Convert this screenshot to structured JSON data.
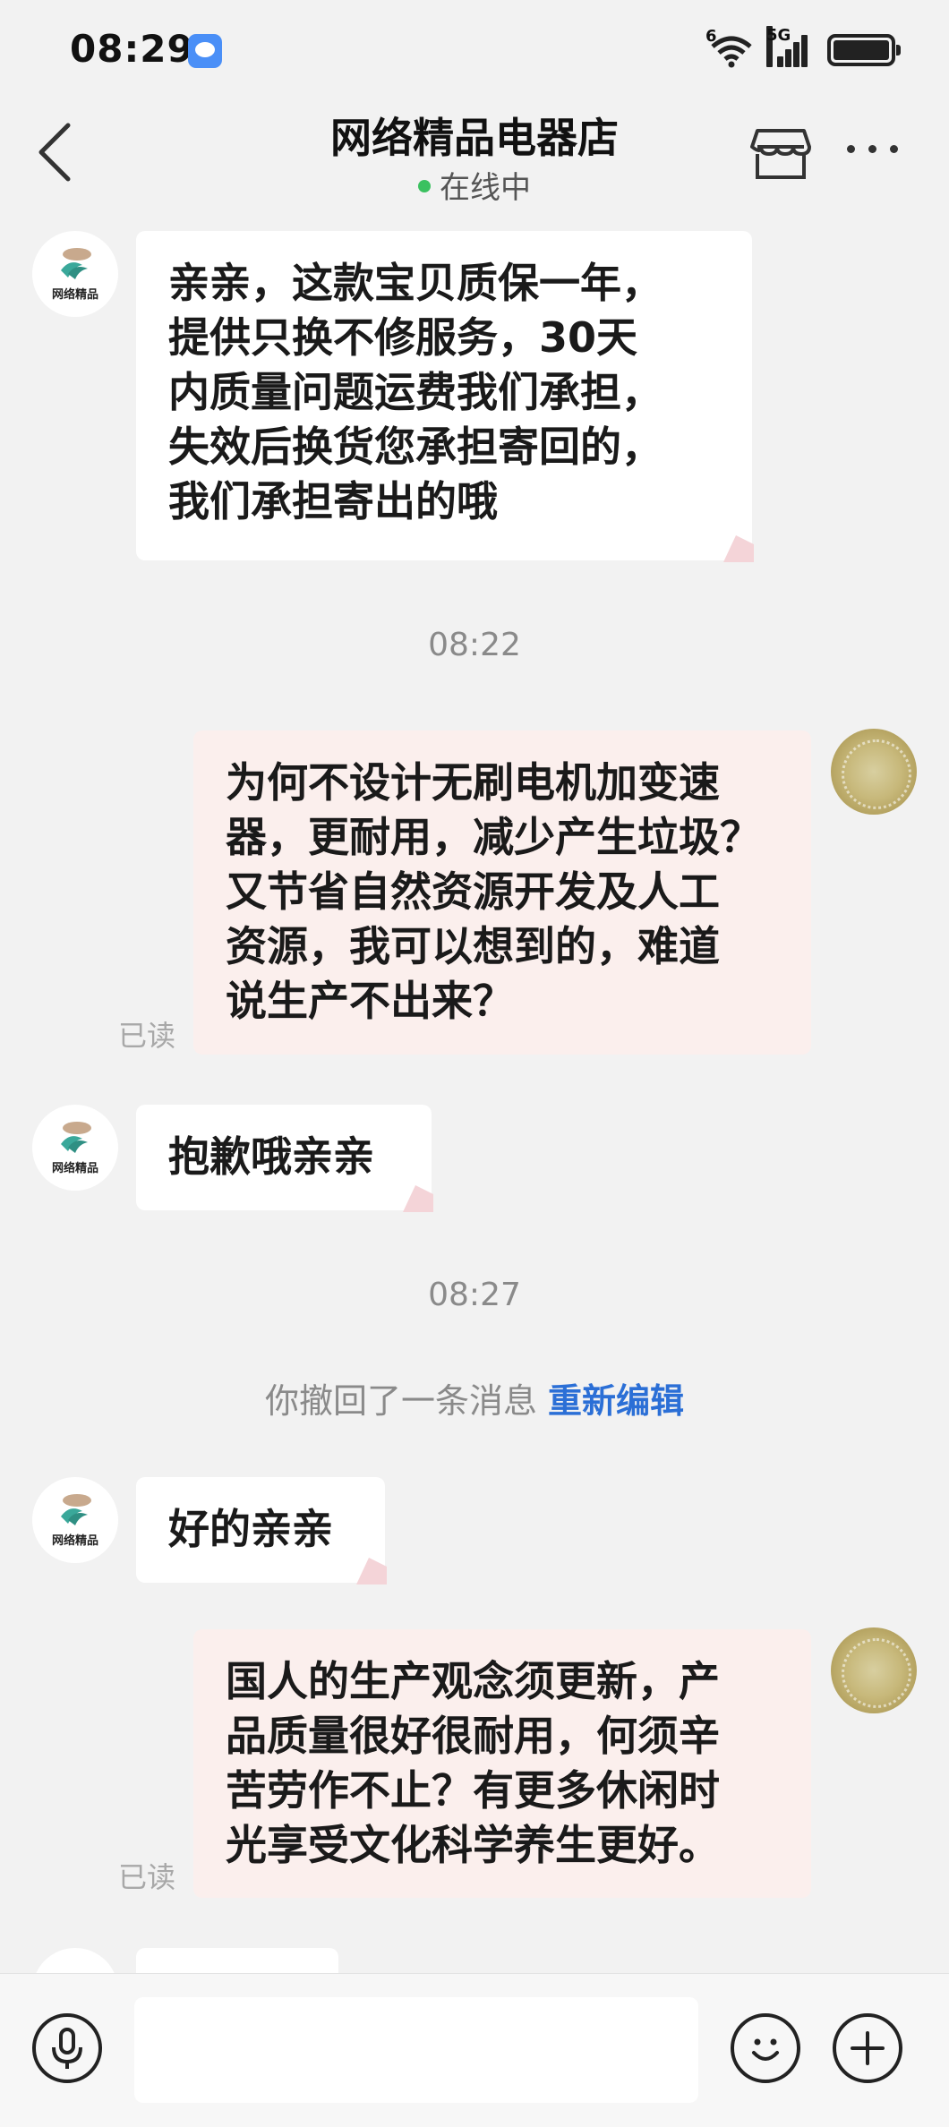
{
  "status_bar": {
    "time": "08:29",
    "network_label": "5G",
    "wifi_label": "6",
    "notification_icon": "chat-bubble-icon"
  },
  "header": {
    "title": "网络精品电器店",
    "status": "在线中",
    "status_color": "#3bc160"
  },
  "shop_avatar_text": "网络精品",
  "messages": [
    {
      "type": "in",
      "text_lines": [
        "亲亲，这款宝贝质保一年，",
        "提供只换不修服务，30天",
        "内质量问题运费我们承担，",
        "失效后换货您承担寄回的，",
        "我们承担寄出的哦"
      ]
    },
    {
      "type": "time",
      "text": "08:22"
    },
    {
      "type": "out",
      "read": "已读",
      "text_lines": [
        "为何不设计无刷电机加变速",
        "器，更耐用，减少产生垃圾？",
        "又节省自然资源开发及人工",
        "资源，我可以想到的，难道",
        "说生产不出来？"
      ]
    },
    {
      "type": "in",
      "text_lines": [
        "抱歉哦亲亲"
      ]
    },
    {
      "type": "time",
      "text": "08:27"
    },
    {
      "type": "recall",
      "text": "你撤回了一条消息",
      "action": "重新编辑"
    },
    {
      "type": "in",
      "text_lines": [
        "好的亲亲"
      ]
    },
    {
      "type": "out",
      "read": "已读",
      "text_lines": [
        "国人的生产观念须更新，产",
        "品质量很好很耐用，何须辛",
        "苦劳作不止？有更多休闲时",
        "光享受文化科学养生更好。"
      ]
    }
  ],
  "input_bar": {
    "placeholder": "",
    "voice_icon": "microphone-icon",
    "emoji_icon": "emoji-icon",
    "plus_icon": "plus-icon"
  },
  "colors": {
    "accent_link": "#2b6fd6",
    "outgoing_bubble": "#fbefed",
    "incoming_bubble": "#ffffff",
    "background": "#f2f2f2"
  }
}
